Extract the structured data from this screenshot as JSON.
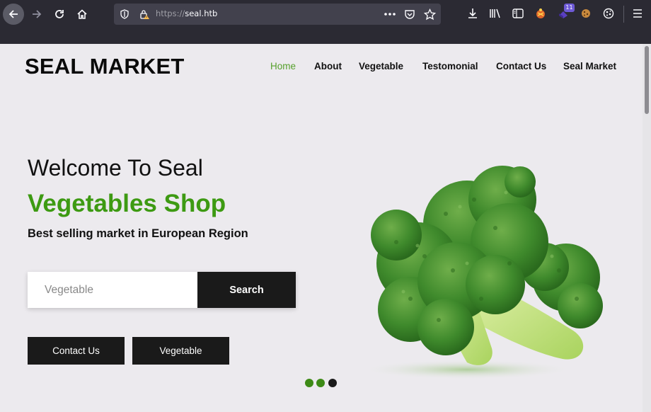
{
  "browser": {
    "url_scheme": "https://",
    "url_host": "seal.htb",
    "extension_badge": "11",
    "icons": [
      "back-icon",
      "forward-icon",
      "reload-icon",
      "home-icon",
      "shield-icon",
      "lock-warning-icon",
      "more-icon",
      "pocket-icon",
      "star-icon",
      "download-icon",
      "library-icon",
      "sidebar-icon",
      "extension-icon",
      "extension-badge-icon",
      "cookie-icon",
      "cookie-alt-icon",
      "menu-icon"
    ]
  },
  "site": {
    "logo": "SEAL MARKET",
    "nav": [
      {
        "label": "Home",
        "active": true
      },
      {
        "label": "About"
      },
      {
        "label": "Vegetable"
      },
      {
        "label": "Testomonial"
      },
      {
        "label": "Contact Us"
      },
      {
        "label": "Seal Market"
      }
    ]
  },
  "hero": {
    "title_line1": "Welcome To Seal",
    "title_line2": "Vegetables Shop",
    "subtitle": "Best selling market in European Region",
    "search_placeholder": "Vegetable",
    "search_button": "Search",
    "cta_contact": "Contact Us",
    "cta_vegetable": "Vegetable",
    "image": "broccoli-image",
    "slides": {
      "total": 3,
      "active": 3
    }
  },
  "colors": {
    "accent_green": "#3d9a12",
    "nav_active": "#56a02c",
    "button_dark": "#1a1a1a",
    "page_bg": "#eceaee",
    "chrome_bg": "#2b2a33"
  }
}
